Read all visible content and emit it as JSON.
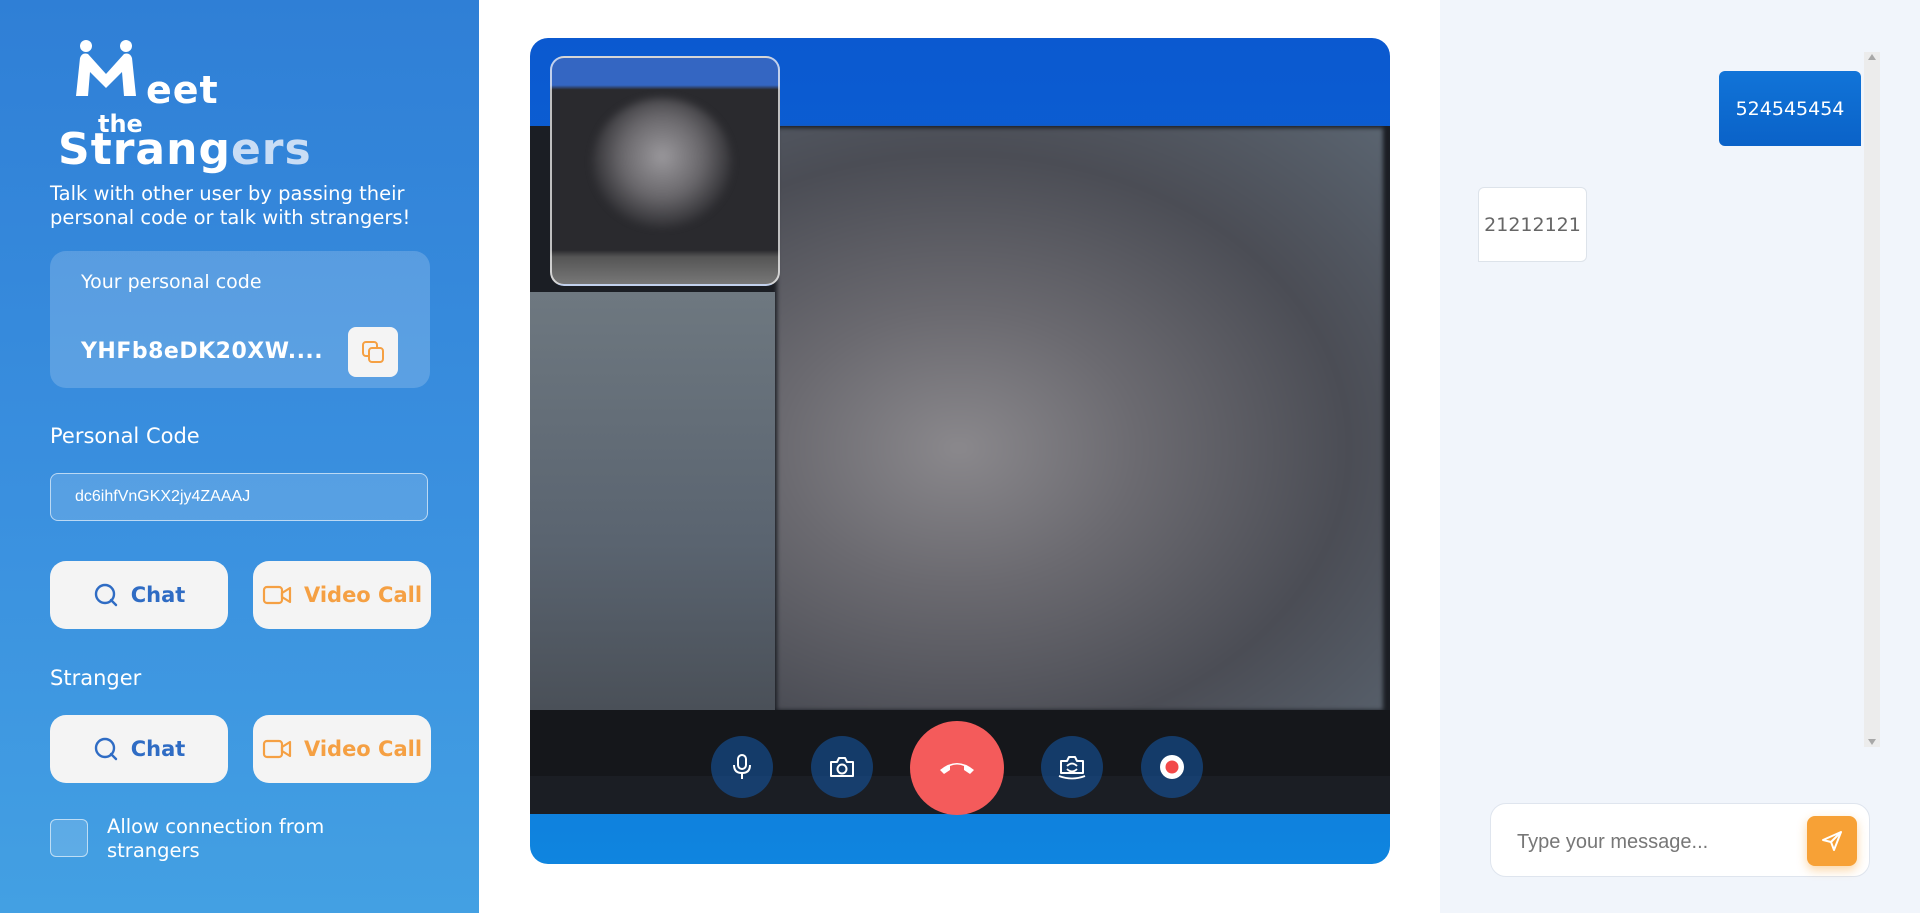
{
  "sidebar": {
    "logo": {
      "line1": "eet",
      "line2": "the",
      "line3_main": "Strang",
      "line3_soft": "ers"
    },
    "tagline": "Talk with other user by passing their personal code or talk with strangers!",
    "personal_code_card": {
      "label": "Your personal code",
      "code": "YHFb8eDK20XW...."
    },
    "personal_section": {
      "title": "Personal Code",
      "input_value": "dc6ihfVnGKX2jy4ZAAAJ",
      "chat_label": "Chat",
      "video_label": "Video Call"
    },
    "stranger_section": {
      "title": "Stranger",
      "chat_label": "Chat",
      "video_label": "Video Call"
    },
    "allow_strangers_label": "Allow connection from strangers",
    "allow_strangers_checked": false
  },
  "video": {
    "controls": [
      "mic-icon",
      "camera-icon",
      "hangup-icon",
      "switch-camera-icon",
      "record-icon"
    ],
    "accent_colors": {
      "hangup": "#f45b5b",
      "frame": "#0b59d0"
    }
  },
  "chat": {
    "messages": [
      {
        "direction": "outgoing",
        "text": "524545454"
      },
      {
        "direction": "incoming",
        "text": "21212121"
      }
    ],
    "input": {
      "placeholder": "Type your message...",
      "value": ""
    },
    "send_color": "#f7a136"
  }
}
